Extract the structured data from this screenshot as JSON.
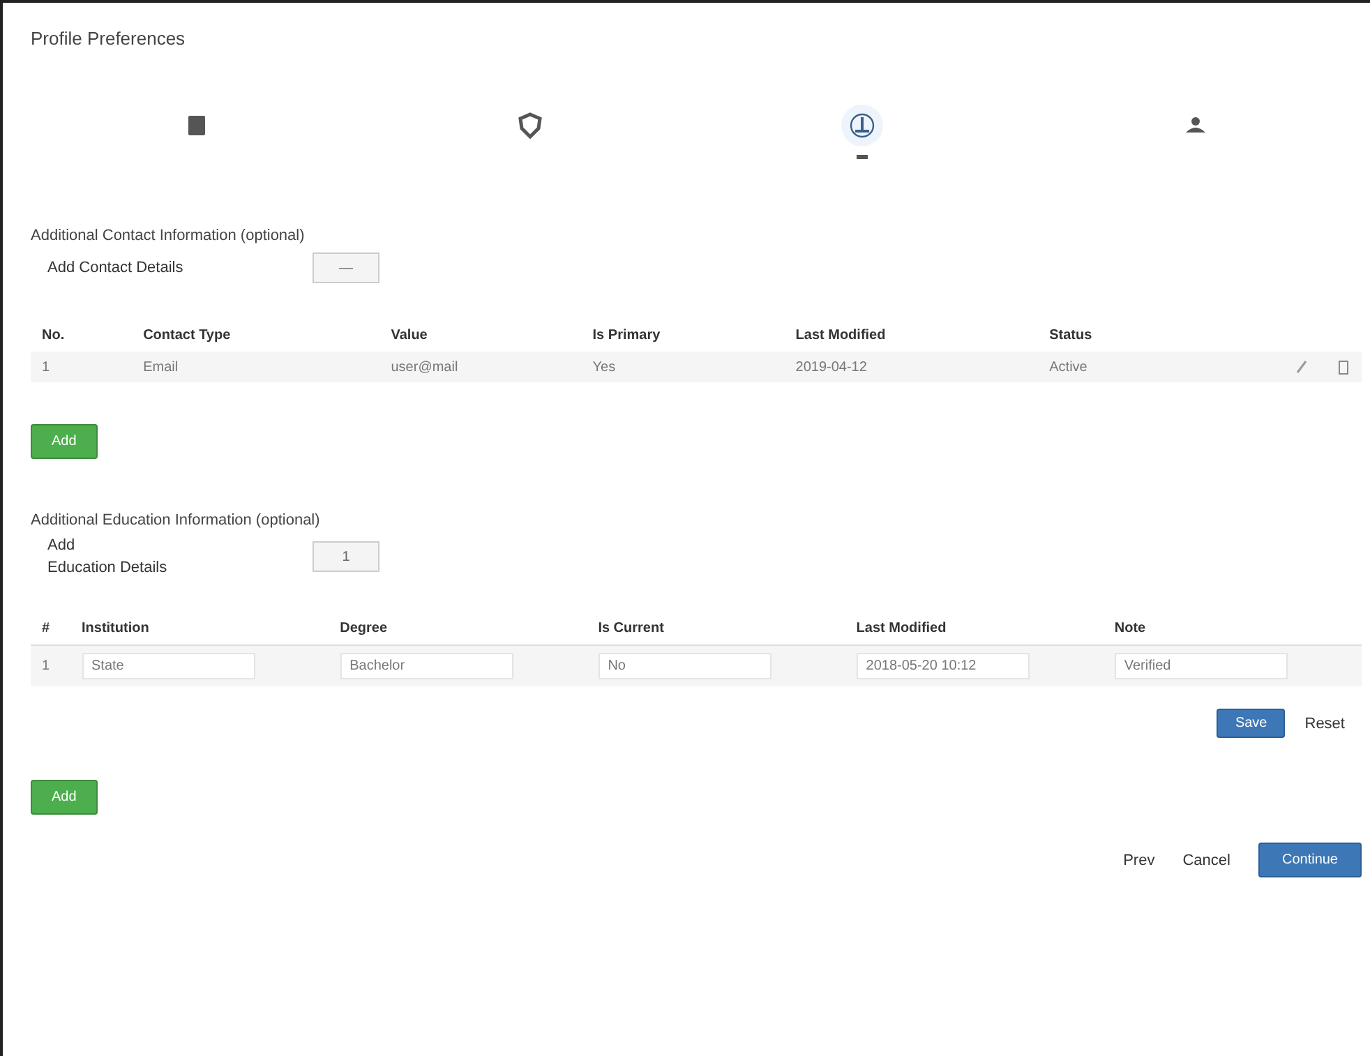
{
  "title": "Profile Preferences",
  "steps": [
    {
      "kind": "card",
      "selected": false
    },
    {
      "kind": "shield",
      "selected": false
    },
    {
      "kind": "person",
      "selected": true
    },
    {
      "kind": "group",
      "selected": false
    }
  ],
  "section_1": {
    "heading": "Additional Contact Information (optional)",
    "field_label": "Add Contact Details",
    "select_value": "—",
    "columns": [
      "No.",
      "Contact Type",
      "Value",
      "Is Primary",
      "Last Modified",
      "Status"
    ],
    "rows": [
      [
        "1",
        "Email",
        "user@mail",
        "Yes",
        "2019-04-12",
        "Active"
      ]
    ],
    "add_button": "Add"
  },
  "section_2": {
    "heading": "Additional Education Information (optional)",
    "field_label_lines": [
      "Add",
      "Education Details"
    ],
    "select_value": "1",
    "columns": [
      "#",
      "Institution",
      "Degree",
      "Is Current",
      "Last Modified",
      "Note"
    ],
    "row": {
      "index": "1",
      "cells": [
        "State",
        "Bachelor",
        "No",
        "2018-05-20 10:12",
        "Verified"
      ]
    },
    "save_button": "Save",
    "reset_link": "Reset",
    "add_button": "Add"
  },
  "footer": {
    "prev": "Prev",
    "cancel": "Cancel",
    "next": "Continue"
  }
}
